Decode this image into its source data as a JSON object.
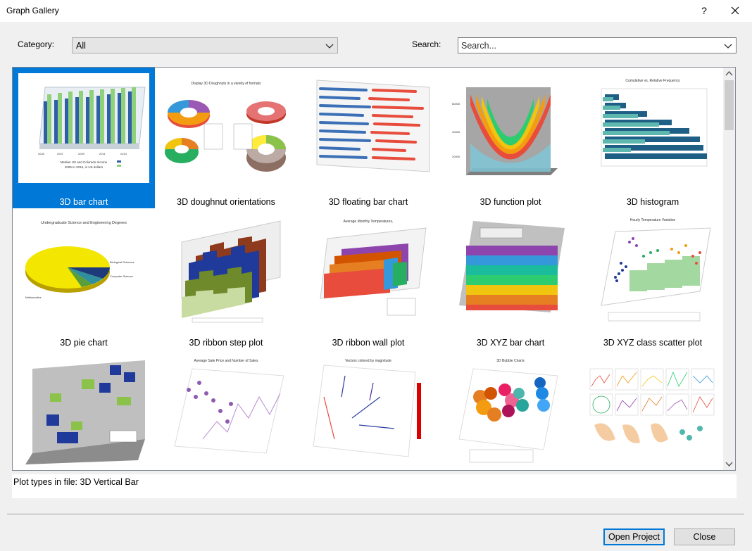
{
  "window": {
    "title": "Graph Gallery",
    "help_glyph": "?"
  },
  "filters": {
    "category_label": "Category:",
    "category_value": "All",
    "search_label": "Search:",
    "search_placeholder": "Search..."
  },
  "gallery": {
    "selected_index": 0,
    "items": [
      {
        "label": "3D bar chart",
        "icon": "bar-chart-3d-thumbnail"
      },
      {
        "label": "3D doughnut orientations",
        "icon": "doughnut-3d-thumbnail"
      },
      {
        "label": "3D floating bar chart",
        "icon": "floating-bar-3d-thumbnail"
      },
      {
        "label": "3D function plot",
        "icon": "function-plot-3d-thumbnail"
      },
      {
        "label": "3D histogram",
        "icon": "histogram-3d-thumbnail"
      },
      {
        "label": "3D pie chart",
        "icon": "pie-chart-3d-thumbnail"
      },
      {
        "label": "3D ribbon step plot",
        "icon": "ribbon-step-3d-thumbnail"
      },
      {
        "label": "3D ribbon wall plot",
        "icon": "ribbon-wall-3d-thumbnail"
      },
      {
        "label": "3D XYZ bar chart",
        "icon": "xyz-bar-3d-thumbnail"
      },
      {
        "label": "3D XYZ class scatter plot",
        "icon": "xyz-scatter-3d-thumbnail"
      },
      {
        "label": "",
        "icon": "boxes-3d-thumbnail"
      },
      {
        "label": "",
        "icon": "scatter-lines-3d-thumbnail"
      },
      {
        "label": "",
        "icon": "vector-plot-3d-thumbnail"
      },
      {
        "label": "",
        "icon": "bubble-3d-thumbnail"
      },
      {
        "label": "",
        "icon": "multi-panel-thumbnail"
      }
    ]
  },
  "status": {
    "text": "Plot types in file: 3D Vertical Bar"
  },
  "buttons": {
    "open_project": "Open Project",
    "close": "Close"
  },
  "colors": {
    "selection": "#0078d7",
    "dialog_bg": "#f0f0f0"
  }
}
